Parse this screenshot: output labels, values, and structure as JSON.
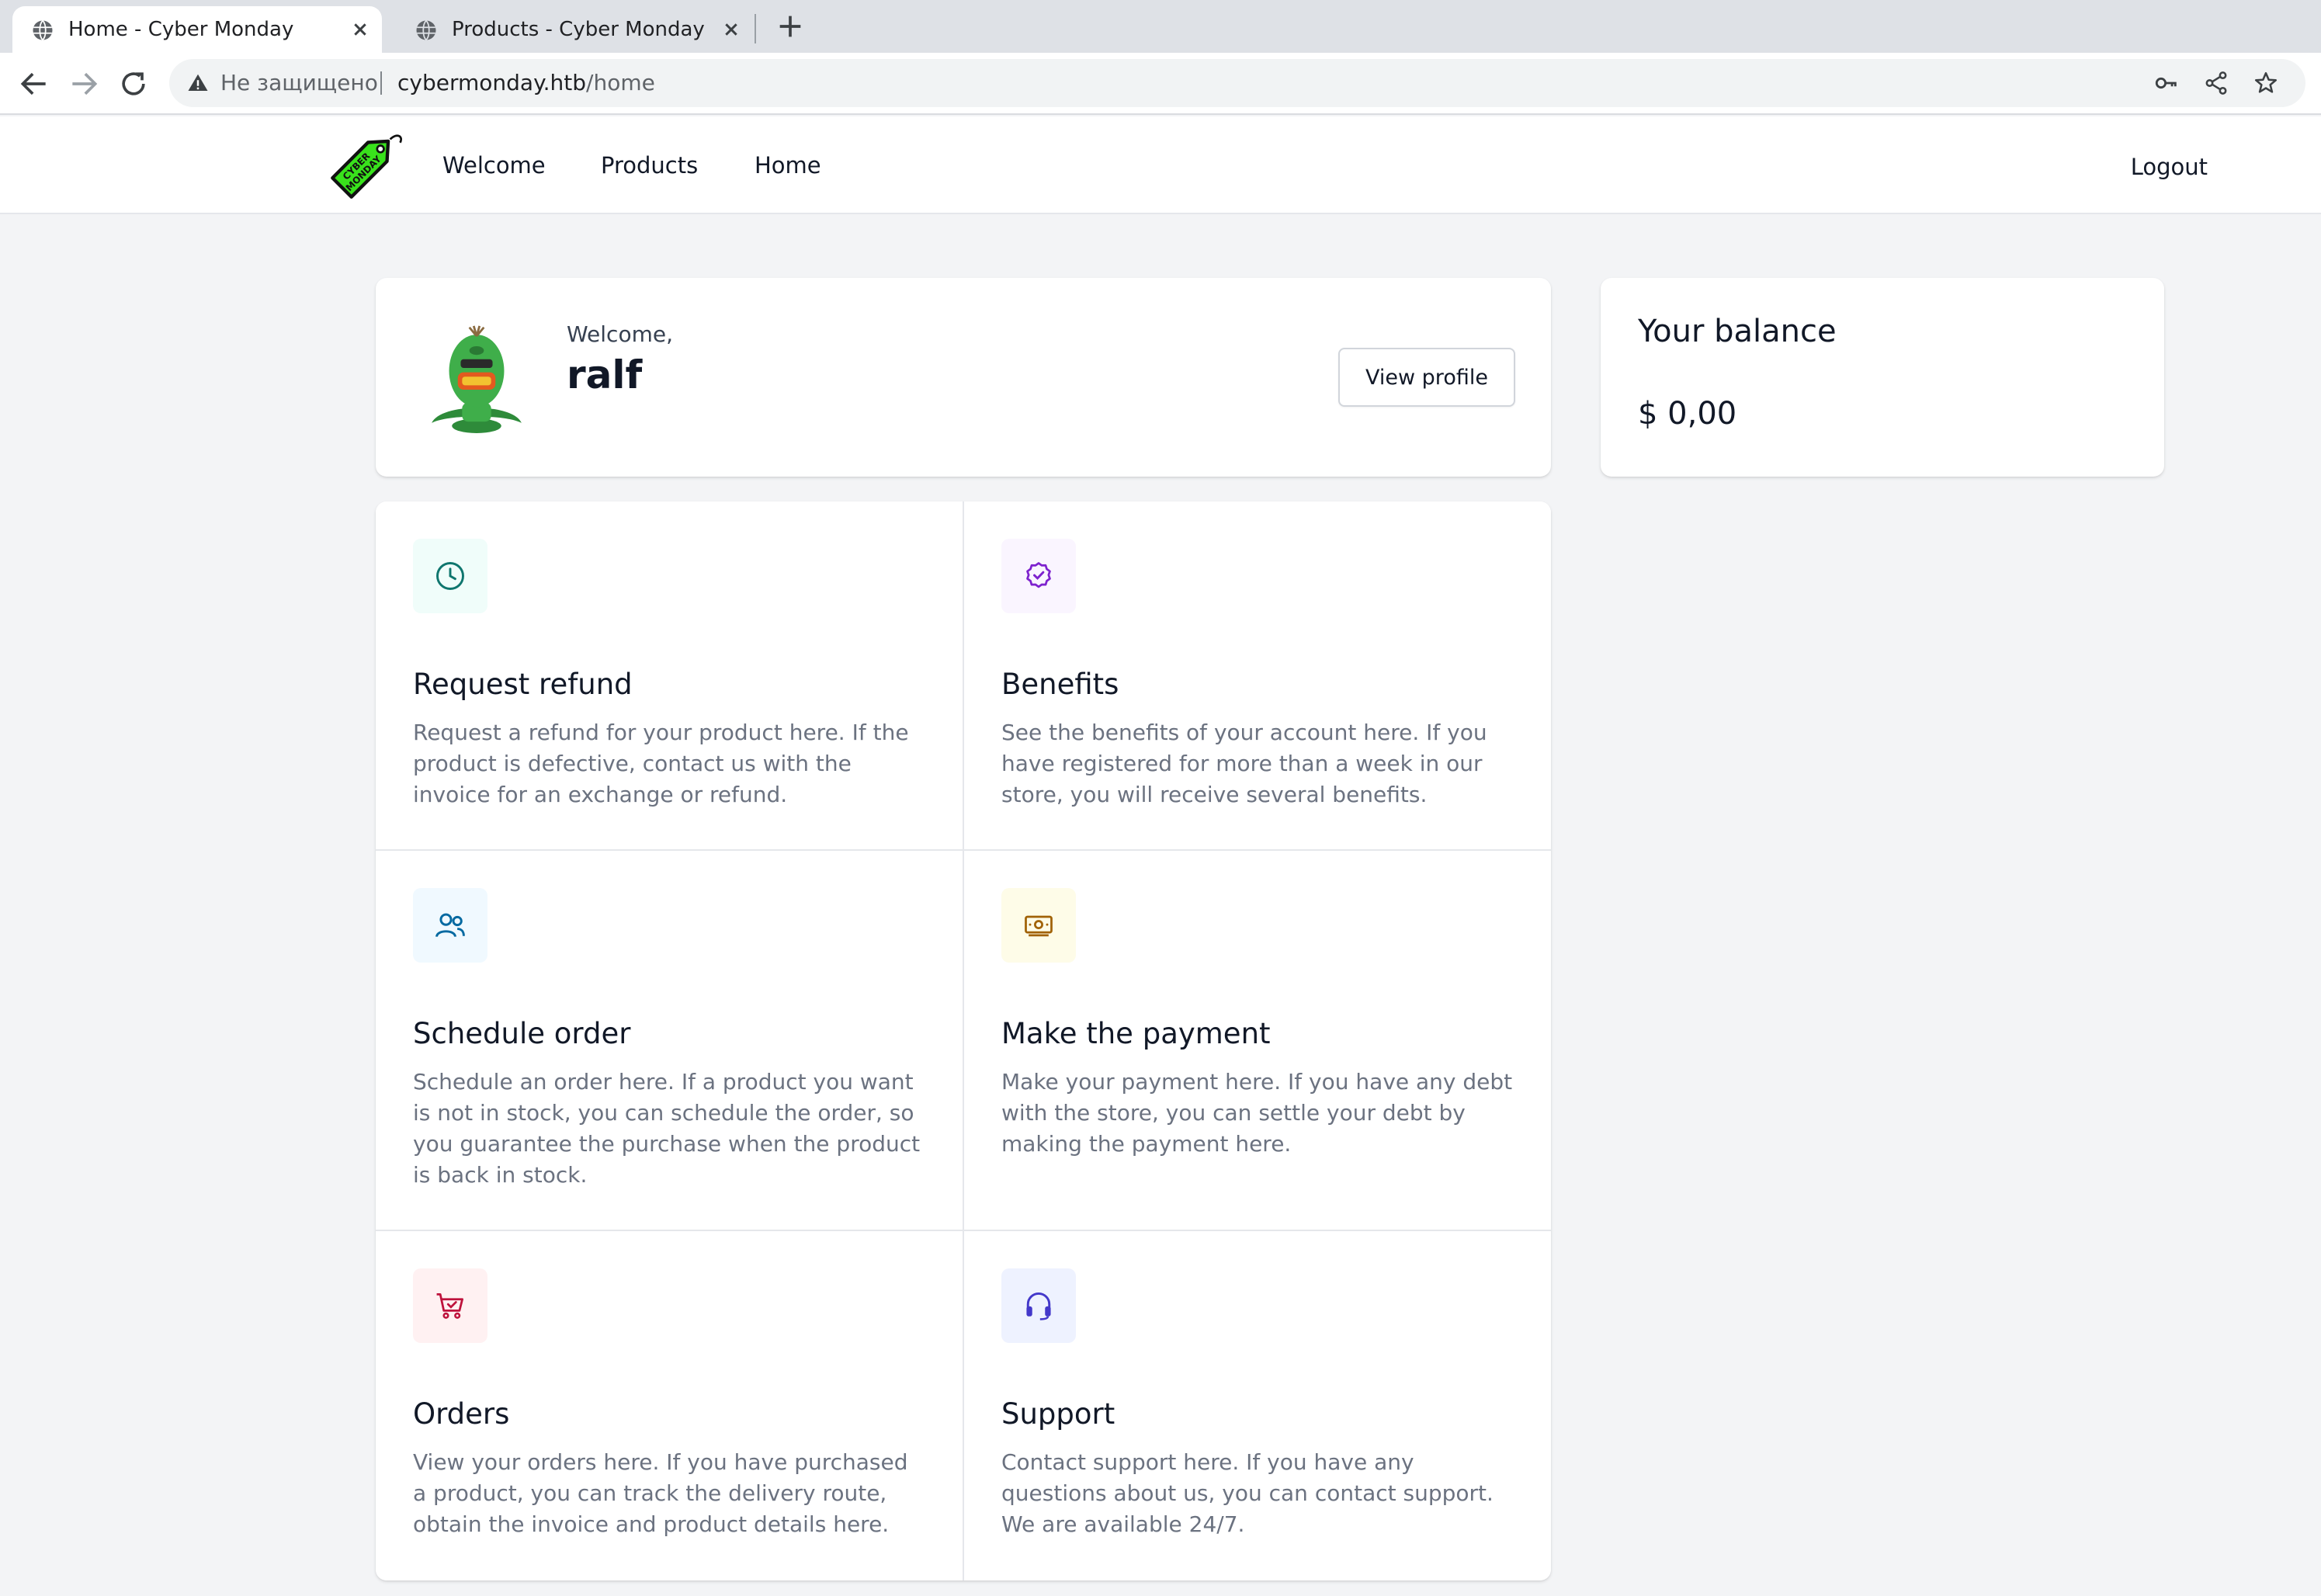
{
  "browser": {
    "tabs": [
      {
        "title": "Home - Cyber Monday",
        "active": true
      },
      {
        "title": "Products - Cyber Monday",
        "active": false
      }
    ],
    "omnibox": {
      "security_label": "Не защищено",
      "url_host": "cybermonday.htb",
      "url_path": "/home"
    }
  },
  "header": {
    "logo_text": "CYBER MONDAY",
    "nav": [
      "Welcome",
      "Products",
      "Home"
    ],
    "logout_label": "Logout"
  },
  "welcome": {
    "greeting": "Welcome,",
    "username": "ralf",
    "view_profile_label": "View profile"
  },
  "balance": {
    "title": "Your balance",
    "value": "$ 0,00"
  },
  "actions": [
    {
      "title": "Request refund",
      "desc": "Request a refund for your product here. If the product is defective, contact us with the invoice for an exchange or refund.",
      "icon": "clock-icon",
      "icon_color": "#0f766e",
      "icon_bg": "#f0fdfa"
    },
    {
      "title": "Benefits",
      "desc": "See the benefits of your account here. If you have registered for more than a week in our store, you will receive several benefits.",
      "icon": "badge-check-icon",
      "icon_color": "#7e22ce",
      "icon_bg": "#faf5ff"
    },
    {
      "title": "Schedule order",
      "desc": "Schedule an order here. If a product you want is not in stock, you can schedule the order, so you guarantee the purchase when the product is back in stock.",
      "icon": "users-icon",
      "icon_color": "#0369a1",
      "icon_bg": "#f0f9ff"
    },
    {
      "title": "Make the payment",
      "desc": "Make your payment here. If you have any debt with the store, you can settle your debt by making the payment here.",
      "icon": "cash-icon",
      "icon_color": "#a16207",
      "icon_bg": "#fefce8"
    },
    {
      "title": "Orders",
      "desc": "View your orders here. If you have purchased a product, you can track the delivery route, obtain the invoice and product details here.",
      "icon": "shopping-cart-icon",
      "icon_color": "#be123c",
      "icon_bg": "#fff1f2"
    },
    {
      "title": "Support",
      "desc": "Contact support here. If you have any questions about us, you can contact support. We are available 24/7.",
      "icon": "headset-icon",
      "icon_color": "#4338ca",
      "icon_bg": "#eef2ff"
    }
  ]
}
